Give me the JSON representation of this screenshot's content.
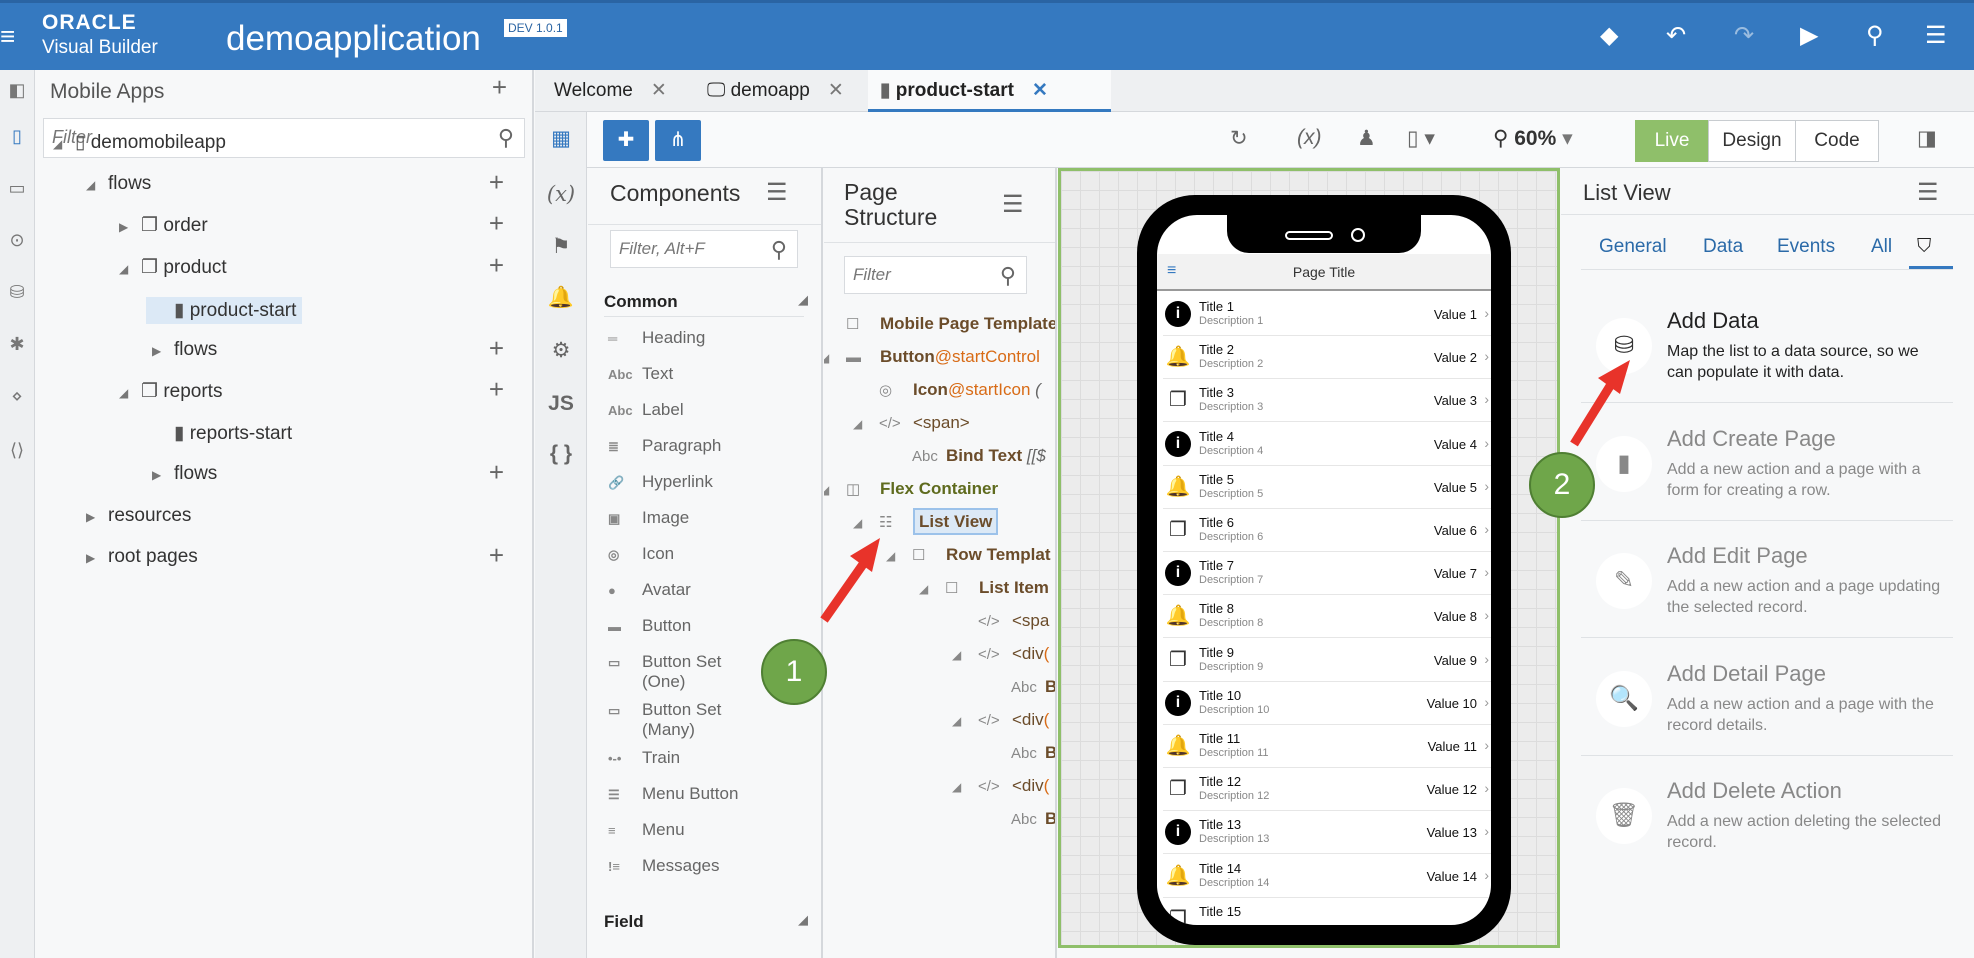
{
  "header": {
    "brand_top": "ORACLE",
    "brand_bottom": "Visual Builder",
    "app_name": "demoapplication",
    "env_badge": "DEV 1.0.1",
    "accent": "#3579c0"
  },
  "left_panel": {
    "title": "Mobile Apps",
    "filter_placeholder": "Filter",
    "tree": [
      {
        "label": "demomobileapp",
        "level": 0,
        "expander": "open",
        "icon": "phone",
        "add": false
      },
      {
        "label": "flows",
        "level": 1,
        "expander": "open",
        "icon": "",
        "add": true
      },
      {
        "label": "order",
        "level": 2,
        "expander": "closed",
        "icon": "pages",
        "add": true
      },
      {
        "label": "product",
        "level": 2,
        "expander": "open",
        "icon": "pages",
        "add": true
      },
      {
        "label": "product-start",
        "level": 3,
        "expander": "none",
        "icon": "page",
        "add": false,
        "selected": true
      },
      {
        "label": "flows",
        "level": 3,
        "expander": "closed",
        "icon": "",
        "add": true
      },
      {
        "label": "reports",
        "level": 2,
        "expander": "open",
        "icon": "pages",
        "add": true
      },
      {
        "label": "reports-start",
        "level": 3,
        "expander": "none",
        "icon": "page",
        "add": false
      },
      {
        "label": "flows",
        "level": 3,
        "expander": "closed",
        "icon": "",
        "add": true
      },
      {
        "label": "resources",
        "level": 1,
        "expander": "closed",
        "icon": "",
        "add": false
      },
      {
        "label": "root pages",
        "level": 1,
        "expander": "closed",
        "icon": "",
        "add": true
      }
    ]
  },
  "tabs": [
    {
      "label": "Welcome",
      "icon": ""
    },
    {
      "label": "demoapp",
      "icon": "monitor"
    },
    {
      "label": "product-start",
      "icon": "page",
      "active": true
    }
  ],
  "toolbar": {
    "zoom": "60%",
    "modes": [
      "Live",
      "Design",
      "Code"
    ],
    "active_mode": "Live",
    "live_color": "#8fbf6a"
  },
  "components": {
    "title": "Components",
    "filter_placeholder": "Filter, Alt+F",
    "section": "Common",
    "section2": "Field",
    "items": [
      {
        "label": "Heading",
        "icon": "heading"
      },
      {
        "label": "Text",
        "icon": "text"
      },
      {
        "label": "Label",
        "icon": "label"
      },
      {
        "label": "Paragraph",
        "icon": "paragraph"
      },
      {
        "label": "Hyperlink",
        "icon": "link"
      },
      {
        "label": "Image",
        "icon": "image"
      },
      {
        "label": "Icon",
        "icon": "icon"
      },
      {
        "label": "Avatar",
        "icon": "avatar"
      },
      {
        "label": "Button",
        "icon": "button"
      },
      {
        "label": "Button Set\n(One)",
        "icon": "buttonset"
      },
      {
        "label": "Button Set\n(Many)",
        "icon": "buttonset"
      },
      {
        "label": "Train",
        "icon": "train"
      },
      {
        "label": "Menu Button",
        "icon": "menubutton"
      },
      {
        "label": "Menu",
        "icon": "menu"
      },
      {
        "label": "Messages",
        "icon": "messages"
      }
    ]
  },
  "page_structure": {
    "title_line1": "Page",
    "title_line2": "Structure",
    "filter_placeholder": "Filter",
    "rows": [
      {
        "label": "Mobile Page Template",
        "suffix": "",
        "level": 0,
        "icon": "box",
        "expander": false
      },
      {
        "label": "Button",
        "suffix": "@startControl",
        "level": 0,
        "icon": "button",
        "expander": true
      },
      {
        "label": "Icon",
        "suffix": "@startIcon",
        "extra": " (",
        "level": 1,
        "icon": "icon",
        "expander": false
      },
      {
        "label": "<span>",
        "suffix": "",
        "level": 1,
        "icon": "code",
        "expander": true,
        "plain": true
      },
      {
        "label": "Bind Text",
        "suffix": "",
        "extra": " [[$",
        "level": 2,
        "icon": "text",
        "expander": false
      },
      {
        "label": "Flex Container",
        "suffix": "",
        "level": 0,
        "icon": "flex",
        "expander": true,
        "green": true
      },
      {
        "label": "List View",
        "suffix": "",
        "level": 1,
        "icon": "list",
        "expander": true,
        "selected": true
      },
      {
        "label": "Row Templat",
        "suffix": "",
        "level": 2,
        "icon": "box",
        "expander": true
      },
      {
        "label": "List Item",
        "suffix": "",
        "level": 3,
        "icon": "box",
        "expander": true
      },
      {
        "label": "<spa",
        "suffix": "",
        "level": 4,
        "icon": "code",
        "expander": false,
        "plain": true
      },
      {
        "label": "<div",
        "suffix": "(",
        "level": 4,
        "icon": "code",
        "expander": true,
        "plain": true
      },
      {
        "label": "B",
        "suffix": "",
        "level": 5,
        "icon": "text",
        "expander": false
      },
      {
        "label": "<div",
        "suffix": "(",
        "level": 4,
        "icon": "code",
        "expander": true,
        "plain": true
      },
      {
        "label": "B",
        "suffix": "",
        "level": 5,
        "icon": "text",
        "expander": false
      },
      {
        "label": "<div",
        "suffix": "(",
        "level": 4,
        "icon": "code",
        "expander": true,
        "plain": true
      },
      {
        "label": "B",
        "suffix": "",
        "level": 5,
        "icon": "text",
        "expander": false
      }
    ]
  },
  "phone": {
    "page_title": "Page Title",
    "rows": [
      {
        "title": "Title 1",
        "desc": "Description 1",
        "value": "Value 1",
        "icon": "info"
      },
      {
        "title": "Title 2",
        "desc": "Description 2",
        "value": "Value 2",
        "icon": "bell"
      },
      {
        "title": "Title 3",
        "desc": "Description 3",
        "value": "Value 3",
        "icon": "copy"
      },
      {
        "title": "Title 4",
        "desc": "Description 4",
        "value": "Value 4",
        "icon": "info"
      },
      {
        "title": "Title 5",
        "desc": "Description 5",
        "value": "Value 5",
        "icon": "bell"
      },
      {
        "title": "Title 6",
        "desc": "Description 6",
        "value": "Value 6",
        "icon": "copy"
      },
      {
        "title": "Title 7",
        "desc": "Description 7",
        "value": "Value 7",
        "icon": "info"
      },
      {
        "title": "Title 8",
        "desc": "Description 8",
        "value": "Value 8",
        "icon": "bell"
      },
      {
        "title": "Title 9",
        "desc": "Description 9",
        "value": "Value 9",
        "icon": "copy"
      },
      {
        "title": "Title 10",
        "desc": "Description 10",
        "value": "Value 10",
        "icon": "info"
      },
      {
        "title": "Title 11",
        "desc": "Description 11",
        "value": "Value 11",
        "icon": "bell"
      },
      {
        "title": "Title 12",
        "desc": "Description 12",
        "value": "Value 12",
        "icon": "copy"
      },
      {
        "title": "Title 13",
        "desc": "Description 13",
        "value": "Value 13",
        "icon": "info"
      },
      {
        "title": "Title 14",
        "desc": "Description 14",
        "value": "Value 14",
        "icon": "bell"
      },
      {
        "title": "Title 15",
        "desc": "",
        "value": "",
        "icon": "copy"
      }
    ]
  },
  "properties": {
    "title": "List View",
    "tabs": [
      "General",
      "Data",
      "Events",
      "All"
    ],
    "active_tab": "quick-start",
    "cards": [
      {
        "title": "Add Data",
        "desc": "Map the list to a data source, so we can populate it with data.",
        "icon": "database",
        "enabled": true
      },
      {
        "title": "Add Create Page",
        "desc": "Add a new action and a page with a form for creating a row.",
        "icon": "new-page",
        "enabled": false
      },
      {
        "title": "Add Edit Page",
        "desc": "Add a new action and a page updating the selected record.",
        "icon": "edit",
        "enabled": false
      },
      {
        "title": "Add Detail Page",
        "desc": "Add a new action and a page with the record details.",
        "icon": "detail",
        "enabled": false
      },
      {
        "title": "Add Delete Action",
        "desc": "Add a new action deleting the selected record.",
        "icon": "trash",
        "enabled": false
      }
    ]
  },
  "annotations": [
    {
      "label": "1",
      "color": "#6fa64a"
    },
    {
      "label": "2",
      "color": "#6fa64a"
    }
  ]
}
